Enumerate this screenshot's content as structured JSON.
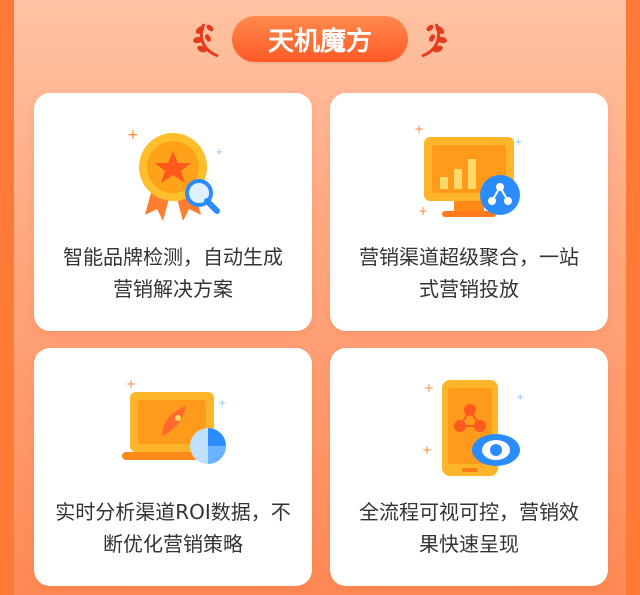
{
  "header": {
    "title": "天机魔方"
  },
  "cards": [
    {
      "icon": "medal-search-icon",
      "line1": "智能品牌检测，自动生成",
      "line2": "营销解决方案"
    },
    {
      "icon": "monitor-chart-share-icon",
      "line1": "营销渠道超级聚合，一站",
      "line2": "式营销投放"
    },
    {
      "icon": "laptop-rocket-pie-icon",
      "line1": "实时分析渠道ROI数据，不",
      "line2": "断优化营销策略"
    },
    {
      "icon": "phone-share-eye-icon",
      "line1": "全流程可视可控，营销效",
      "line2": "果快速呈现"
    }
  ],
  "colors": {
    "accent": "#ff6a2f",
    "gold": "#ffb400",
    "blue": "#2a8cff"
  }
}
